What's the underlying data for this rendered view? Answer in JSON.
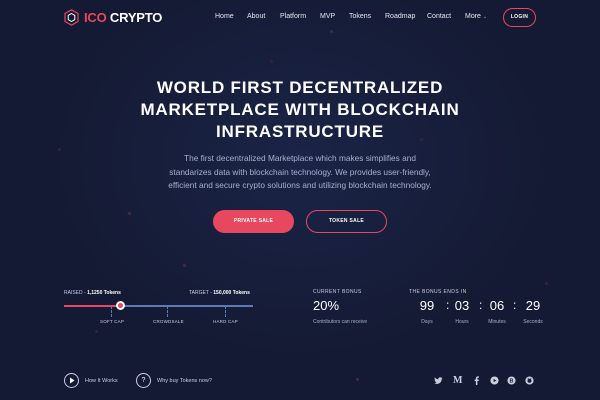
{
  "brand": {
    "name_accent": "ICO",
    "name_main": " CRYPTO",
    "accent_color": "#e8485f",
    "bg_color": "#141a33"
  },
  "nav": {
    "items": [
      "Home",
      "About",
      "Platform",
      "MVP",
      "Tokens",
      "Roadmap",
      "Contact",
      "More"
    ],
    "login_label": "LOGIN"
  },
  "hero": {
    "title_line1": "WORLD FIRST DECENTRALIZED",
    "title_line2": "MARKETPLACE WITH BLOCKCHAIN",
    "title_line3": "INFRASTRUCTURE",
    "text_line1": "The first decentralized Marketplace which makes simplifies and",
    "text_line2": "standarizes data with blockchain technology. We provides user-friendly,",
    "text_line3": "efficient and secure crypto solutions and utilizing blockchain technology.",
    "private_sale_label": "PRIVATE SALE",
    "token_sale_label": "TOKEN SALE"
  },
  "progress": {
    "raised_label": "RAISED - ",
    "raised_value": "1,1250 Tokens",
    "target_label": "TARGET - ",
    "target_value": "150,000 Tokens",
    "fill_percent": 30,
    "milestones": [
      "SOFT CAP",
      "CROWDSALE",
      "HARD CAP"
    ]
  },
  "bonus": {
    "title": "CURRENT BONUS",
    "value": "20%",
    "caption": "Contributors can receive"
  },
  "countdown": {
    "title": "THE BONUS ENDS IN",
    "units": [
      {
        "value": "99",
        "label": "Days"
      },
      {
        "value": "03",
        "label": "Hours"
      },
      {
        "value": "06",
        "label": "Minutes"
      },
      {
        "value": "29",
        "label": "Seconds"
      }
    ]
  },
  "footer": {
    "how_it_works": "How It Works",
    "why_buy": "Why buy Tokens now?",
    "social_icons": [
      "twitter-icon",
      "medium-icon",
      "facebook-icon",
      "youtube-icon",
      "bitcoin-icon",
      "github-icon"
    ]
  }
}
